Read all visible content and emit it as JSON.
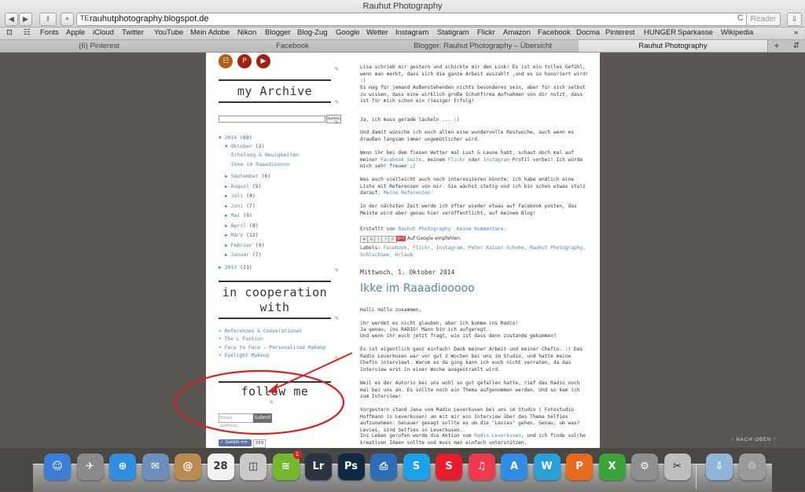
{
  "window": {
    "title": "Rauhut Photography"
  },
  "toolbar": {
    "back": "◀",
    "forward": "▶",
    "share": "⇪",
    "add": "+",
    "site_icon": "TE",
    "url": "rauhutphotography.blogspot.de",
    "reload": "C",
    "reader": "Reader",
    "downloads": "⇩"
  },
  "bookmarks": [
    "Fonts",
    "Apple",
    "iCloud",
    "Twitter",
    "YouTube",
    "Mein Adobe",
    "Nikon",
    "Blogger",
    "Blog-Zug",
    "Google",
    "Wetter",
    "Instagram",
    "Statigram",
    "Flickr",
    "Amazon",
    "Facebook",
    "Docma",
    "Pinterest",
    "HUNGER",
    "Sparkasse",
    "Wikipedia"
  ],
  "tabs": [
    "(6) Pinterest",
    "Facebook",
    "Blogger: Rauhut Photography – Übersicht",
    "Rauhut Photography"
  ],
  "tab_plus": "+",
  "tab_overflow": "⇵",
  "sidebar": {
    "social": [
      "☷",
      "P",
      "▶"
    ],
    "archive_title": "my Archive",
    "search_button": "Suchen",
    "archive": {
      "y2014": {
        "label": "2014",
        "count": "(69)"
      },
      "oct": {
        "label": "Oktober",
        "count": "(2)"
      },
      "posts": [
        "Erholung & Neuigkeiten",
        "Ikke im Raaadiooooo"
      ],
      "months": [
        {
          "label": "September",
          "count": "(6)"
        },
        {
          "label": "August",
          "count": "(5)"
        },
        {
          "label": "Juli",
          "count": "(4)"
        },
        {
          "label": "Juni",
          "count": "(7)"
        },
        {
          "label": "Mai",
          "count": "(9)"
        },
        {
          "label": "April",
          "count": "(8)"
        },
        {
          "label": "März",
          "count": "(12)"
        },
        {
          "label": "Februar",
          "count": "(9)"
        },
        {
          "label": "Januar",
          "count": "(7)"
        }
      ],
      "y2013": {
        "label": "2013",
        "count": "(21)"
      }
    },
    "coop_title_1": "in cooperation",
    "coop_title_2": "with",
    "coop_links": [
      "Referenzen & Cooperationen",
      "The L Fashion",
      "Face to Face - Personalized MakeUp",
      "Eyelight Makeup"
    ],
    "follow_title": "follow me",
    "email_placeholder": "Email address...",
    "submit": "Submit",
    "fb_like": "Gefällt mir",
    "fb_count": "359"
  },
  "main": {
    "p1": "Lisa schrieb mir gestern und schickte mir den Link! Es ist ein tolles Gefühl, wenn man merkt, dass sich die ganze Arbeit auszahlt ,und es so honoriert wird! :)",
    "p2": "Es mag für jemand Außenstehenden nichts besonderes sein, aber für sich selbst zu wissen, dass eine wirklich große Schuhfirma Aufnahmen von dir nutzt, dass ist für mich schon ein riesiger Erfolg!",
    "p3": "Ja, ich muss gerade lächeln ... :)",
    "p4": "Und damit wünsche ich euch allen eine wundervolle Restwoche, auch wenn es draußen langsam immer ungemütlicher wird.",
    "p5a": "Wenn ihr bei dem fiesen Wetter mal Lust & Laune habt, schaut doch mal auf meiner ",
    "p5_fb": "Facebook Seite",
    "p5b": ", meinem ",
    "p5_fl": "Flickr",
    "p5c": " oder ",
    "p5_ig": "Instagram",
    "p5d": " Profil vorbei! Ich würde mich sehr freuen ;)",
    "p6a": "Was euch vielleicht auch noch interessieren könnte, ich habe endlich eine Liste mit Referenzen von mir. Sie wächst stetig und ich bin schon etwas stolz darauf. ",
    "p6_ref": "Meine Referenzen.",
    "p7": "In der nächsten Zeit werde ich öfter wieder etwas auf Facebook posten, das Meiste wird aber genau hier veröffentlicht, auf meinem Blog!",
    "footer_created": "Erstellt von ",
    "footer_author": "Rauhut Photography",
    "footer_comments": "Keine Kommentare:",
    "share_buttons": [
      "M",
      "B",
      "t",
      "f",
      "P"
    ],
    "gplus": "g+1",
    "gplus_label": "Auf Google empfehlen",
    "labels_prefix": "Labels: ",
    "labels": "Facebook, Flickr, Instagram, Peter Kaiser Schuhe, Rauhut Photography, Schluchsee, Urlaub",
    "post_date": "Mittwoch, 1. Oktober 2014",
    "post_title": "Ikke im Raaadiooooo",
    "q1": "Halli Hallo zusammen,",
    "q2": "ihr werdet es nicht glauben, aber ich komme ins Radio!",
    "q3": "Ja genau, ins RADIO! Mann bin ich aufgeregt.",
    "q4": "Und wenn ihr euch jetzt fragt, wie ist dass denn zustande gekommen?",
    "q5": "Es ist eigentlich ganz einfach! Dank meiner Arbeit und meiner Chefin. :) Das Radio Leverkusen war vor gut 2 Wochen bei uns im Studio, und hatte meine Chefin interviewt. Warum es da ging kann ich euch nicht verraten, da das Interview erst in einer Woche ausgestrahlt wird.",
    "q6": "Weil es der Autorin bei uns wohl so gut gefallen hatte, rief das Radio noch mal bei uns an. Es sollte noch ein Thema aufgenommen werden. Und so kam ich zum Interview!",
    "q7": "Vorgestern stand Jana vom Radio Leverkusen bei uns im Studio ( Fotostudio Hoffmann in Leverkusen) um mit mir ein Interview über das Thema Selfies aufzunehmen. Genauer gesagt sollte es um die \"Levies\" gehen. Genau, um was? Levies, sind Selfies in Leverkusen.",
    "q8a": "Ins Leben gerufen wurde die Aktion vom ",
    "q8_link": "Radio Leverkusen",
    "q8b": ", und ich finde solche kreativen Ideen sollte und muss man einfach unterstützen."
  },
  "to_top": "↑ NACH OBEN ↑",
  "dock": {
    "icons": [
      {
        "name": "finder-icon",
        "label": "☺",
        "color": "#3d7fd6"
      },
      {
        "name": "launchpad-icon",
        "label": "✈",
        "color": "#8a8a8a"
      },
      {
        "name": "safari-icon",
        "label": "⊕",
        "color": "#2e8fe0"
      },
      {
        "name": "mail-icon",
        "label": "✉",
        "color": "#6b8fb8"
      },
      {
        "name": "contacts-icon",
        "label": "@",
        "color": "#b98a4e"
      },
      {
        "name": "calendar-icon",
        "label": "28",
        "color": "#f2f2f2"
      },
      {
        "name": "preview-icon",
        "label": "◫",
        "color": "#c9c9c9"
      },
      {
        "name": "spotify-icon",
        "label": "≋",
        "color": "#74b62c"
      },
      {
        "name": "lightroom-icon",
        "label": "Lr",
        "color": "#2b3542"
      },
      {
        "name": "photoshop-icon",
        "label": "Ps",
        "color": "#0e2a45"
      },
      {
        "name": "printer-icon",
        "label": "⎙",
        "color": "#2d6db8"
      },
      {
        "name": "skype-icon",
        "label": "S",
        "color": "#1ba2e6"
      },
      {
        "name": "flashcard-icon",
        "label": "S",
        "color": "#e81c2a"
      },
      {
        "name": "music-icon",
        "label": "♫",
        "color": "#ee3a4f"
      },
      {
        "name": "appstore-icon",
        "label": "A",
        "color": "#2f8de8"
      },
      {
        "name": "word-icon",
        "label": "W",
        "color": "#2aa0d8"
      },
      {
        "name": "powerpoint-icon",
        "label": "P",
        "color": "#e86a1c"
      },
      {
        "name": "excel-icon",
        "label": "X",
        "color": "#3aa53a"
      },
      {
        "name": "system-preferences-icon",
        "label": "⚙",
        "color": "#8f8f8f"
      },
      {
        "name": "utilities-icon",
        "label": "✂",
        "color": "#bdbdbd"
      },
      {
        "name": "downloads-folder-icon",
        "label": "⇩",
        "color": "#8fb6da"
      },
      {
        "name": "trash-icon",
        "label": "♲",
        "color": "#9a9a9a"
      }
    ],
    "spotify_badge": "1"
  },
  "annotation_color": "#d6221f"
}
